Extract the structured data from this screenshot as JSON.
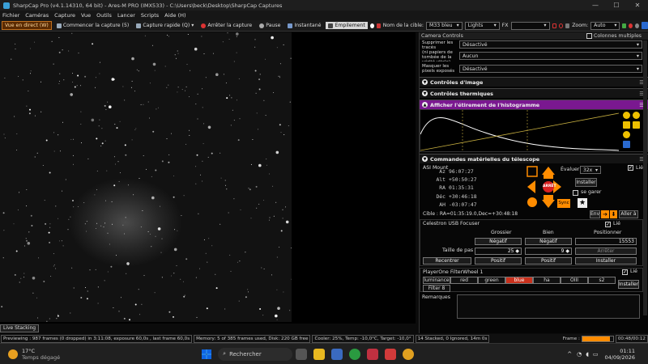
{
  "window": {
    "title": "SharpCap Pro (v4.1.14310, 64 bit) - Ares-M PRO (IMX533) - C:\\Users\\beck\\Desktop\\SharpCap Captures",
    "min": "—",
    "max": "☐",
    "close": "✕"
  },
  "menu": [
    "Fichier",
    "Caméras",
    "Capture",
    "Vue",
    "Outils",
    "Lancer",
    "Scripts",
    "Aide (H)"
  ],
  "toolbar": {
    "live": "Vue en direct (W)",
    "start_capture": "Commencer la capture (5)",
    "quick_capture": "Capture rapide (Q)",
    "stop_capture": "Arrêter la capture",
    "pause": "Pause",
    "snapshot": "Instantané",
    "stacking": "Empilement",
    "target_label": "Nom de la cible:",
    "target_value": "M33 bleu",
    "frame_type": "Lights",
    "fx_label": "FX",
    "zoom_label": "Zoom:",
    "zoom_value": "Auto"
  },
  "panel": {
    "header": "Camera Controls",
    "multi_columns": "Colonnes multiples",
    "rows": [
      {
        "label": "Supprimer les tracés satellites ('ni papiers de tombée de la vérité vitale')",
        "value": "Désactivé"
      },
      {
        "label": "(ni papiers de tombée de la vérité vitale)",
        "value": "Aucun"
      },
      {
        "label": "Masquer les pixels exposés",
        "value": "Désactivé"
      }
    ],
    "sections": {
      "image": "Contrôles d'image",
      "thermal": "Contrôles thermiques",
      "histogram": "Afficher l'étirement de l'histogramme",
      "telescope": "Commandes matérielles du télescope"
    }
  },
  "mount": {
    "name": "ASI Mount",
    "linked": "Lié",
    "coords": [
      {
        "k": "Az",
        "v": "96:07:27"
      },
      {
        "k": "Alt",
        "v": "+50:50:27"
      },
      {
        "k": "RA",
        "v": "01:35:31"
      },
      {
        "k": "Déc",
        "v": "+30:46:18"
      },
      {
        "k": "AH",
        "v": "-03:07:47"
      }
    ],
    "stop": "ARRÊT",
    "slew_label": "Évaluer:",
    "slew_value": "32x",
    "install": "Installer",
    "park": "se garer",
    "sync": "Sync",
    "target": "Cible : RA=01:35:19.0,Dec=+30:48:18",
    "on": "Env",
    "goto": "Aller à"
  },
  "focuser": {
    "name": "Celestron USB Focuser",
    "linked": "Lié",
    "cols": [
      "Grossier",
      "Bien",
      "Positionner"
    ],
    "neg": "Négatif",
    "pos": "Positif",
    "position": "15553",
    "step_label": "Taille de pas",
    "coarse_step": "25",
    "fine_step": "9",
    "stop": "Arrêter",
    "recenter": "Recentrer",
    "install": "Installer"
  },
  "filterwheel": {
    "name": "PlayerOne FilterWheel 1",
    "linked": "Lié",
    "filters": [
      "luminance",
      "red",
      "green",
      "blue",
      "ha",
      "OIII",
      "s2",
      "Filter 8"
    ],
    "selected": "blue",
    "install": "Installer"
  },
  "remarks": "Remarques",
  "status": {
    "live": "Live Stacking",
    "preview": "Previewing : 987 frames (0 dropped) in 3:11:08, exposure 60,0s , last frame 60,0s",
    "memory": "Memory: 5 of 385 frames used, Disk: 220 GB free",
    "cooler": "Cooler: 25%, Temp: -10,0°C, Target: -10,0°",
    "stack": "14 Stacked, 0 Ignored, 14m 0s",
    "frame_label": "Frame :",
    "frame_progress": 0.9,
    "elapsed": "00:48/00:12"
  },
  "taskbar": {
    "weather_temp": "17°C",
    "weather_desc": "Temps dégagé",
    "search": "Rechercher",
    "time": "01:11",
    "date": "04/09/2026"
  },
  "colors": {
    "accent": "#ff8c00",
    "hist_bar": "#7a1890",
    "selected_filter": "#c9301c"
  }
}
